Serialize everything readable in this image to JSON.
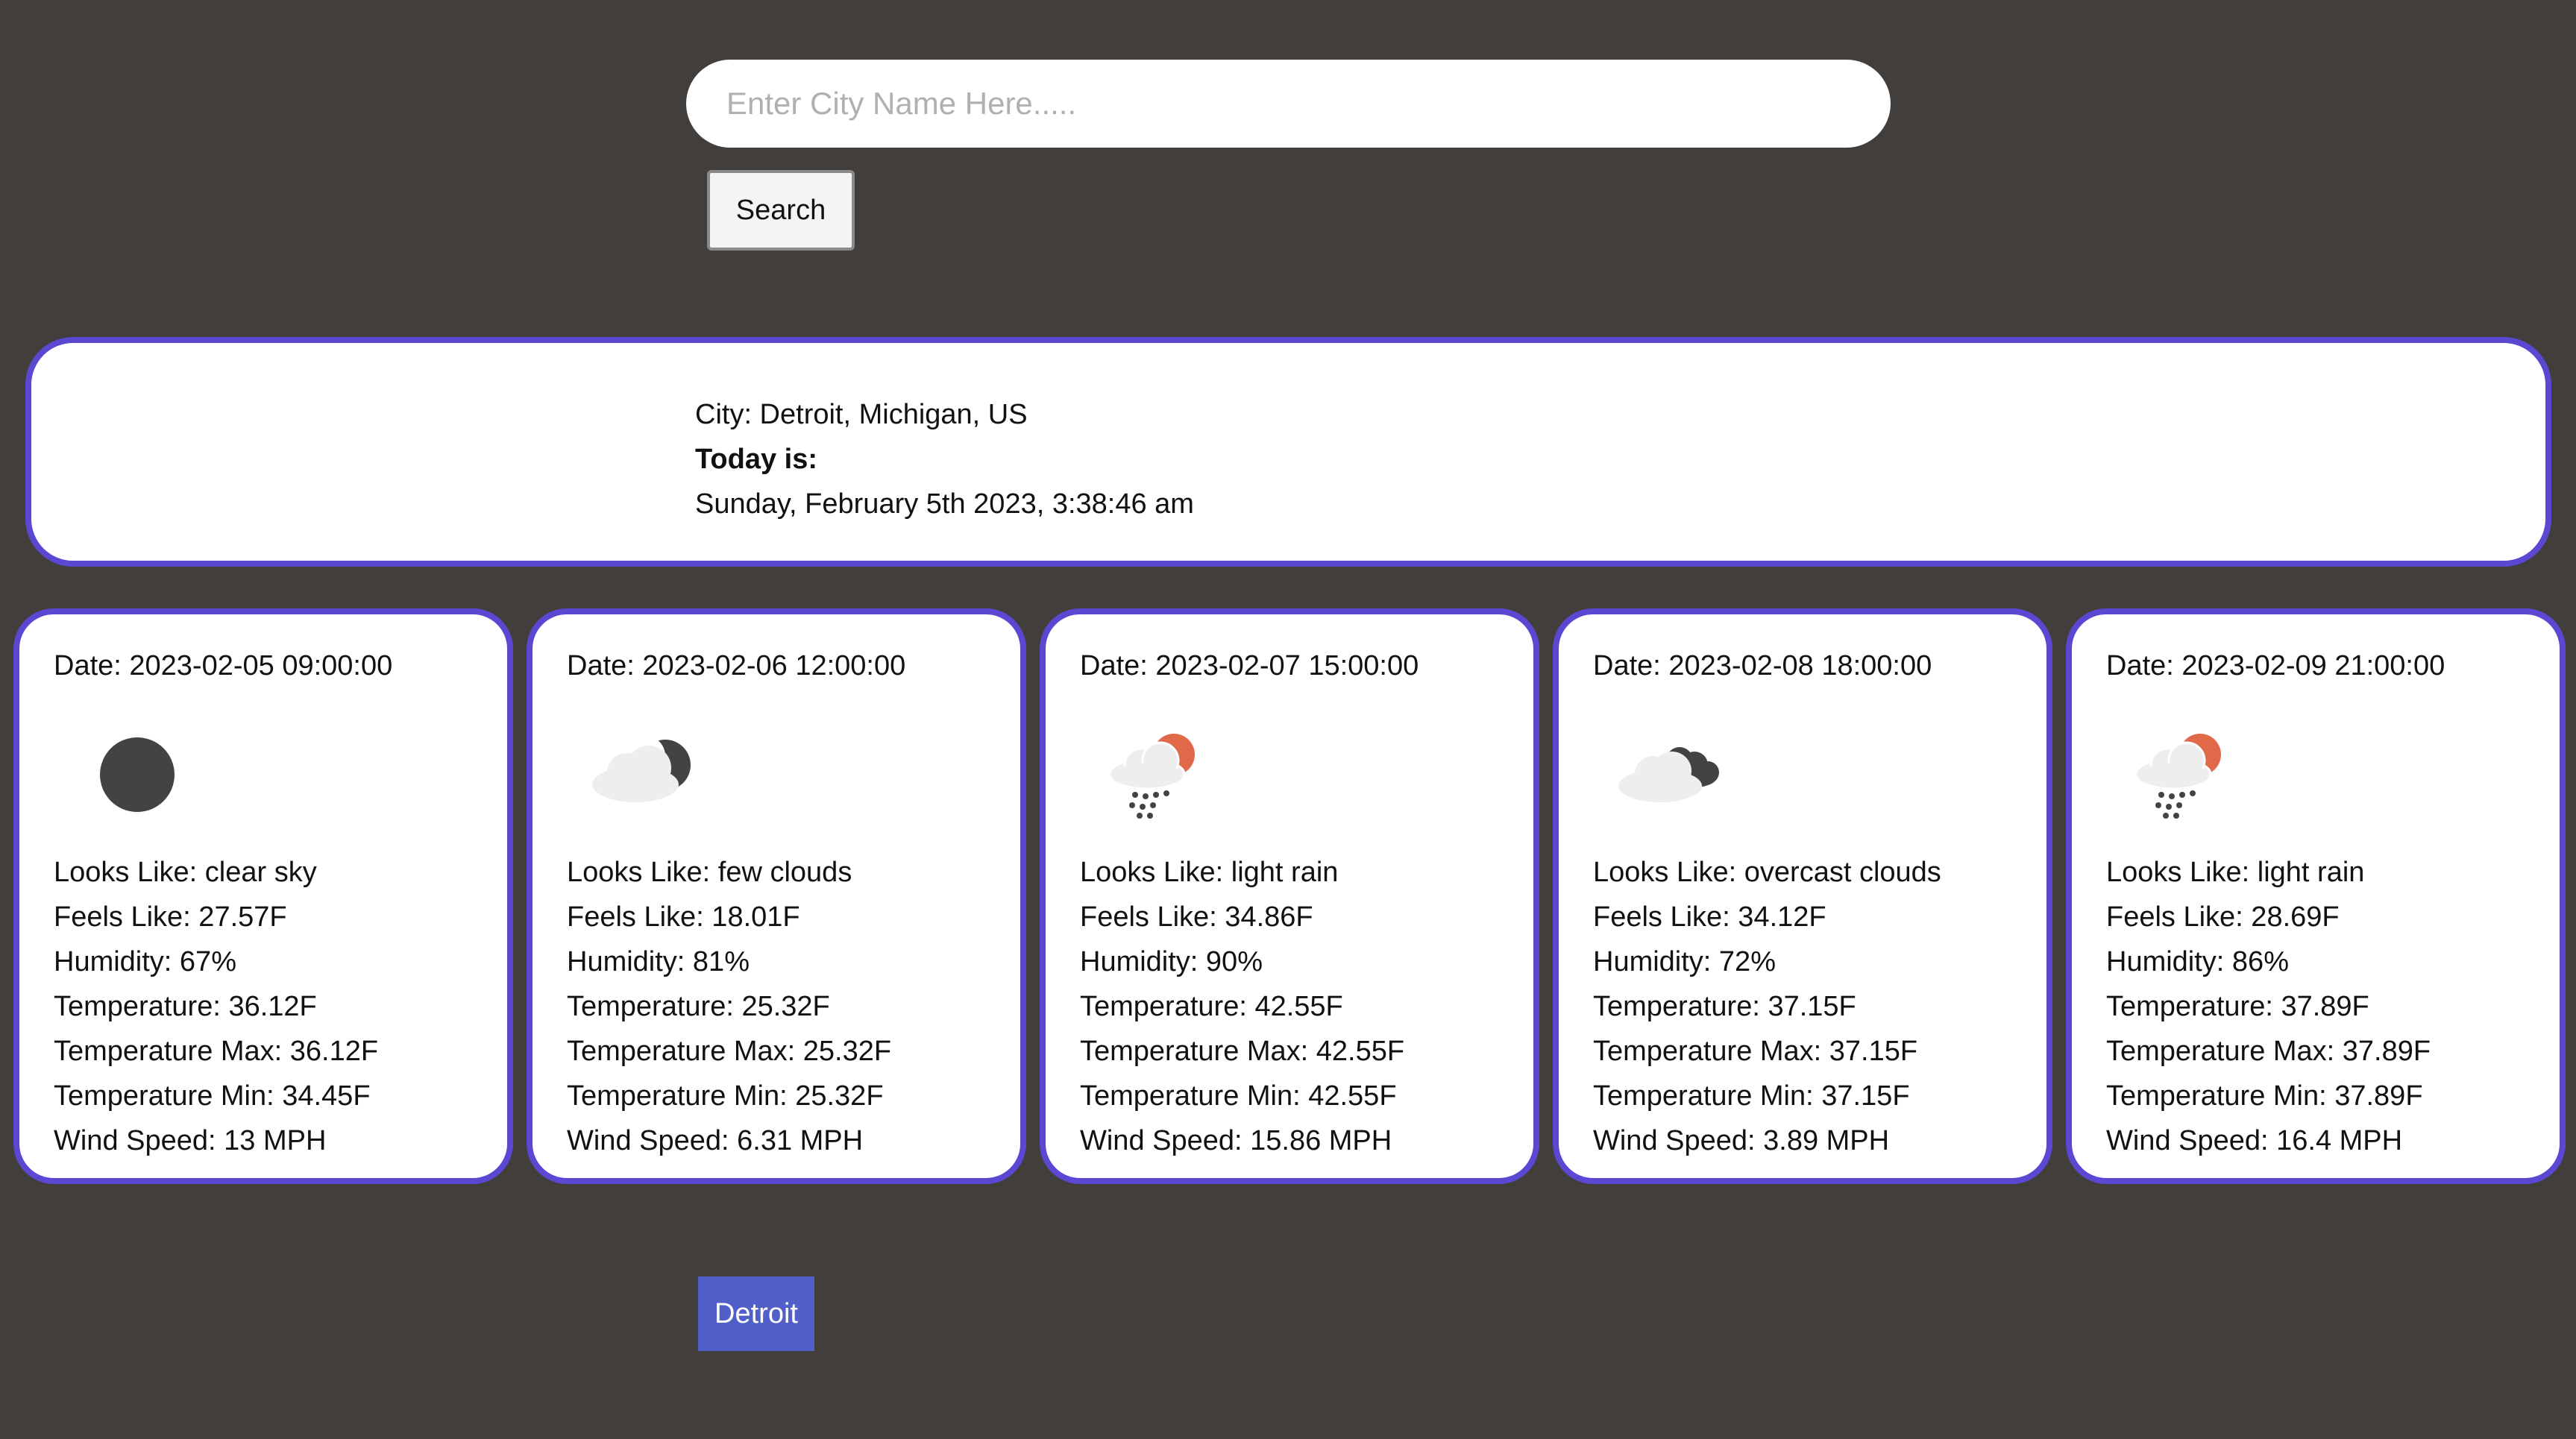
{
  "search": {
    "placeholder": "Enter City Name Here.....",
    "value": "",
    "button_label": "Search"
  },
  "current": {
    "city": "City: Detroit, Michigan, US",
    "today_label": "Today is:",
    "datetime": "Sunday, February 5th 2023, 3:38:46 am"
  },
  "forecast": [
    {
      "date": "Date: 2023-02-05 09:00:00",
      "icon": "clear-sky-night-icon",
      "looks_like": "Looks Like: clear sky",
      "feels_like": "Feels Like: 27.57F",
      "humidity": "Humidity: 67%",
      "temperature": "Temperature: 36.12F",
      "temperature_max": "Temperature Max: 36.12F",
      "temperature_min": "Temperature Min: 34.45F",
      "wind_speed": "Wind Speed: 13 MPH"
    },
    {
      "date": "Date: 2023-02-06 12:00:00",
      "icon": "few-clouds-night-icon",
      "looks_like": "Looks Like: few clouds",
      "feels_like": "Feels Like: 18.01F",
      "humidity": "Humidity: 81%",
      "temperature": "Temperature: 25.32F",
      "temperature_max": "Temperature Max: 25.32F",
      "temperature_min": "Temperature Min: 25.32F",
      "wind_speed": "Wind Speed: 6.31 MPH"
    },
    {
      "date": "Date: 2023-02-07 15:00:00",
      "icon": "light-rain-icon",
      "looks_like": "Looks Like: light rain",
      "feels_like": "Feels Like: 34.86F",
      "humidity": "Humidity: 90%",
      "temperature": "Temperature: 42.55F",
      "temperature_max": "Temperature Max: 42.55F",
      "temperature_min": "Temperature Min: 42.55F",
      "wind_speed": "Wind Speed: 15.86 MPH"
    },
    {
      "date": "Date: 2023-02-08 18:00:00",
      "icon": "overcast-clouds-icon",
      "looks_like": "Looks Like: overcast clouds",
      "feels_like": "Feels Like: 34.12F",
      "humidity": "Humidity: 72%",
      "temperature": "Temperature: 37.15F",
      "temperature_max": "Temperature Max: 37.15F",
      "temperature_min": "Temperature Min: 37.15F",
      "wind_speed": "Wind Speed: 3.89 MPH"
    },
    {
      "date": "Date: 2023-02-09 21:00:00",
      "icon": "light-rain-icon",
      "looks_like": "Looks Like: light rain",
      "feels_like": "Feels Like: 28.69F",
      "humidity": "Humidity: 86%",
      "temperature": "Temperature: 37.89F",
      "temperature_max": "Temperature Max: 37.89F",
      "temperature_min": "Temperature Min: 37.89F",
      "wind_speed": "Wind Speed: 16.4 MPH"
    }
  ],
  "history": {
    "buttons": [
      "Detroit"
    ]
  },
  "colors": {
    "background": "#423e3c",
    "card_border": "#5a48d3",
    "history_button": "#5060c8",
    "sun_accent": "#e0694a",
    "dark_icon": "#434343",
    "cloud": "#eeeeee"
  }
}
